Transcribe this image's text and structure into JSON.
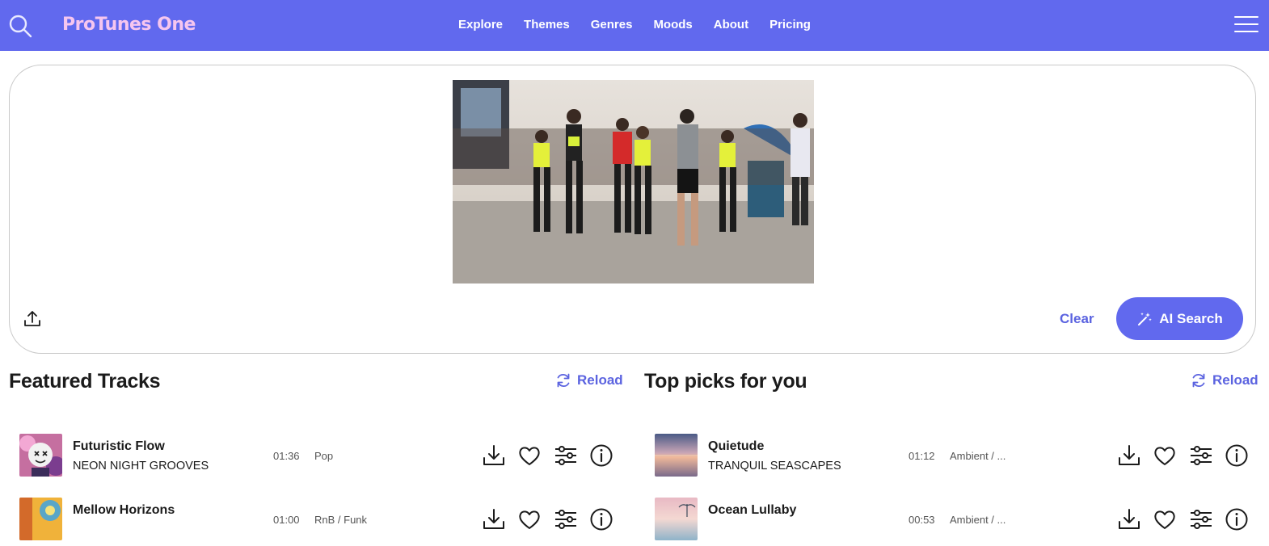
{
  "nav": {
    "logo": "ProTunes One",
    "links": [
      "Explore",
      "Themes",
      "Genres",
      "Moods",
      "About",
      "Pricing"
    ]
  },
  "upload": {
    "clear_label": "Clear",
    "ai_search_label": "AI Search"
  },
  "featured": {
    "title": "Featured Tracks",
    "reload_label": "Reload",
    "tracks": [
      {
        "title": "Futuristic Flow",
        "artist": "NEON NIGHT GROOVES",
        "duration": "01:36",
        "genre": "Pop"
      },
      {
        "title": "Mellow Horizons",
        "artist": "",
        "duration": "01:00",
        "genre": "RnB / Funk"
      }
    ]
  },
  "top_picks": {
    "title": "Top picks for you",
    "reload_label": "Reload",
    "tracks": [
      {
        "title": "Quietude",
        "artist": "TRANQUIL SEASCAPES",
        "duration": "01:12",
        "genre": "Ambient / ..."
      },
      {
        "title": "Ocean Lullaby",
        "artist": "",
        "duration": "00:53",
        "genre": "Ambient / ..."
      }
    ]
  },
  "colors": {
    "brand": "#6169ee",
    "accent_text": "#5b63e0",
    "logo": "#f6c6ef"
  }
}
